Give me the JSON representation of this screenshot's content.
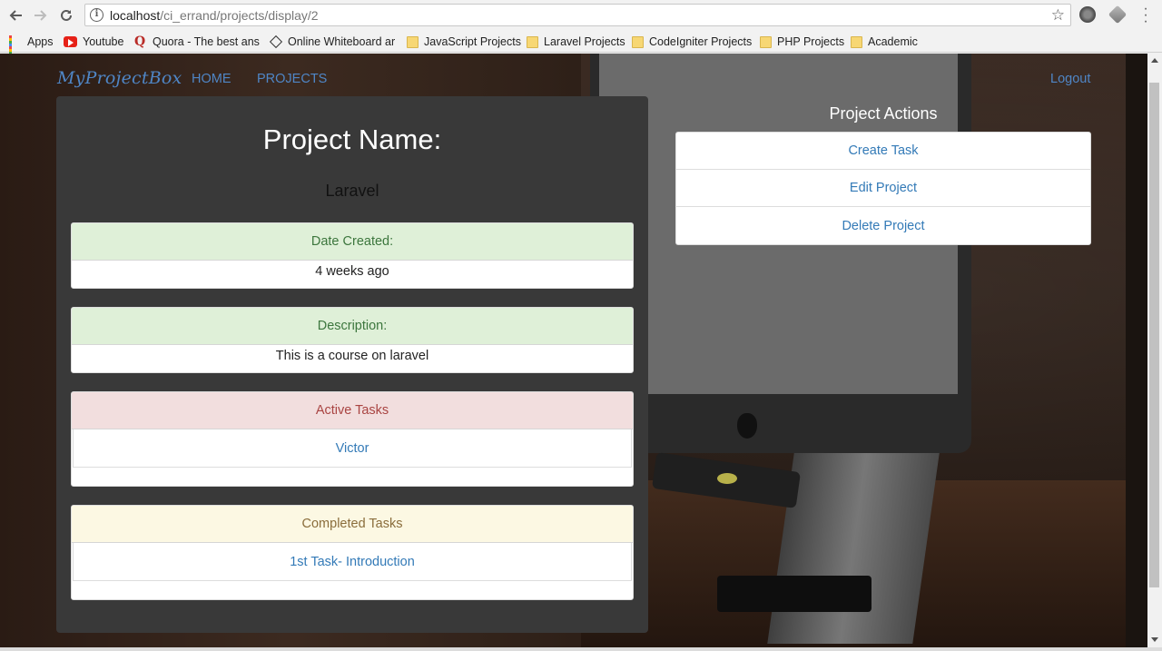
{
  "browser": {
    "url_host": "localhost",
    "url_path": "/ci_errand/projects/display/2",
    "bookmarks": [
      {
        "label": "Apps",
        "icon": "apps-grid-icon"
      },
      {
        "label": "Youtube",
        "icon": "youtube-icon"
      },
      {
        "label": "Quora - The best ans",
        "icon": "quora-icon"
      },
      {
        "label": "Online Whiteboard ar",
        "icon": "whiteboard-icon"
      },
      {
        "label": "JavaScript Projects",
        "icon": "folder-icon"
      },
      {
        "label": "Laravel Projects",
        "icon": "folder-icon"
      },
      {
        "label": "CodeIgniter Projects",
        "icon": "folder-icon"
      },
      {
        "label": "PHP Projects",
        "icon": "folder-icon"
      },
      {
        "label": "Academic",
        "icon": "folder-icon"
      }
    ]
  },
  "navbar": {
    "brand": "MyProjectBox",
    "links": [
      "HOME",
      "PROJECTS"
    ],
    "logout": "Logout"
  },
  "project": {
    "title": "Project Name:",
    "name": "Laravel",
    "date_created": {
      "heading": "Date Created:",
      "value": "4 weeks ago"
    },
    "description": {
      "heading": "Description:",
      "value": "This is a course on laravel"
    },
    "active_tasks": {
      "heading": "Active Tasks",
      "items": [
        "Victor"
      ]
    },
    "completed_tasks": {
      "heading": "Completed Tasks",
      "items": [
        "1st Task- Introduction"
      ]
    }
  },
  "actions": {
    "title": "Project Actions",
    "items": [
      "Create Task",
      "Edit Project",
      "Delete Project"
    ]
  },
  "colors": {
    "link": "#337ab7",
    "brand": "#4f86c6",
    "panel": "#393939",
    "success_bg": "#dff0d8",
    "danger_bg": "#f2dede",
    "warning_bg": "#fcf8e3"
  }
}
